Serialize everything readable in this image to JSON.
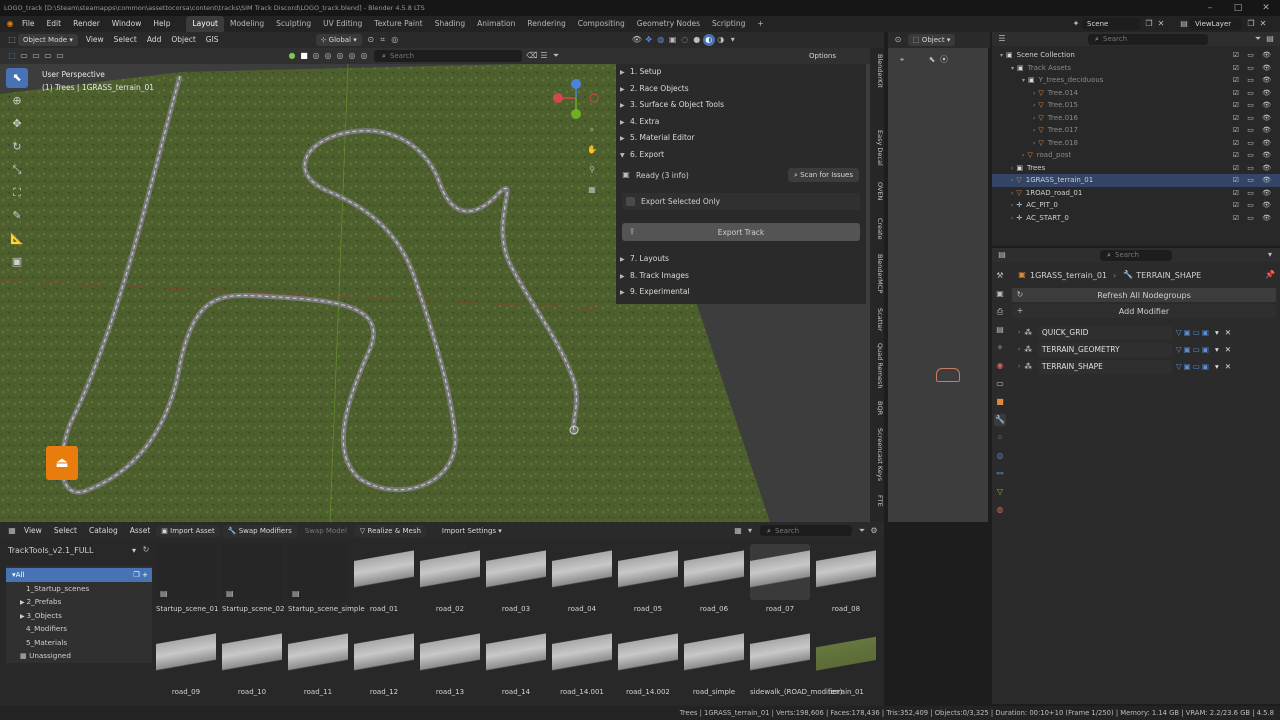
{
  "window": {
    "title": "LOGO_track [D:\\Steam\\steamapps\\common\\assettocorsa\\content\\tracks\\SIM Track Discord\\LOGO_track.blend] - Blender 4.5.8 LTS"
  },
  "menu": [
    "File",
    "Edit",
    "Render",
    "Window",
    "Help"
  ],
  "workspaces": [
    "Layout",
    "Modeling",
    "Sculpting",
    "UV Editing",
    "Texture Paint",
    "Shading",
    "Animation",
    "Rendering",
    "Compositing",
    "Geometry Nodes",
    "Scripting"
  ],
  "scene_name": "Scene",
  "viewlayer_name": "ViewLayer",
  "viewport": {
    "mode": "Object Mode",
    "menus": [
      "View",
      "Select",
      "Add",
      "Object",
      "GIS"
    ],
    "transform": "Global",
    "search_placeholder": "Search",
    "options": "Options",
    "info_line1": "User Perspective",
    "info_line2": "(1) Trees | 1GRASS_terrain_01"
  },
  "npanel": {
    "items": [
      "1. Setup",
      "2. Race Objects",
      "3. Surface & Object Tools",
      "4. Extra",
      "5. Material Editor",
      "6. Export"
    ],
    "status": "Ready (3 info)",
    "scan_button": "Scan for Issues",
    "export_selected": "Export Selected Only",
    "export_track": "Export Track",
    "items2": [
      "7. Layouts",
      "8. Track Images",
      "9. Experimental"
    ]
  },
  "vtabs": [
    "BlenderKit",
    "Easy Decal",
    "OVEN",
    "Create",
    "BlenderMCP",
    "Scatter",
    "Quad Remesh",
    "BQR",
    "Screencast Keys",
    "FTE"
  ],
  "right_viewport": {
    "mode": "Object"
  },
  "outliner": {
    "search_placeholder": "Search",
    "rows": [
      {
        "label": "Scene Collection",
        "indent": 0,
        "icon": "collection-icon"
      },
      {
        "label": "Track Assets",
        "indent": 1,
        "icon": "collection-icon",
        "dim": true
      },
      {
        "label": "Y_trees_deciduous",
        "indent": 2,
        "icon": "collection-icon",
        "dim": true
      },
      {
        "label": "Tree.014",
        "indent": 3,
        "icon": "mesh-icon",
        "dim": true
      },
      {
        "label": "Tree.015",
        "indent": 3,
        "icon": "mesh-icon",
        "dim": true
      },
      {
        "label": "Tree.016",
        "indent": 3,
        "icon": "mesh-icon",
        "dim": true
      },
      {
        "label": "Tree.017",
        "indent": 3,
        "icon": "mesh-icon",
        "dim": true
      },
      {
        "label": "Tree.018",
        "indent": 3,
        "icon": "mesh-icon",
        "dim": true
      },
      {
        "label": "road_post",
        "indent": 2,
        "icon": "mesh-icon",
        "dim": true
      },
      {
        "label": "Trees",
        "indent": 1,
        "icon": "collection-icon"
      },
      {
        "label": "1GRASS_terrain_01",
        "indent": 1,
        "icon": "mesh-icon"
      },
      {
        "label": "1ROAD_road_01",
        "indent": 1,
        "icon": "mesh-icon"
      },
      {
        "label": "AC_PIT_0",
        "indent": 1,
        "icon": "empty-icon"
      },
      {
        "label": "AC_START_0",
        "indent": 1,
        "icon": "empty-icon"
      }
    ]
  },
  "properties": {
    "search_placeholder": "Search",
    "object": "1GRASS_terrain_01",
    "modifier_path": "TERRAIN_SHAPE",
    "refresh": "Refresh All Nodegroups",
    "add_modifier": "Add Modifier",
    "modifiers": [
      "QUICK_GRID",
      "TERRAIN_GEOMETRY",
      "TERRAIN_SHAPE"
    ]
  },
  "asset_browser": {
    "menus": [
      "View",
      "Select",
      "Catalog",
      "Asset"
    ],
    "actions": [
      "Import Asset",
      "Swap Modifiers",
      "Swap Model",
      "Realize & Mesh"
    ],
    "import_settings": "Import Settings",
    "search_placeholder": "Search",
    "library": "TrackTools_v2.1_FULL",
    "catalogs": [
      "All",
      "1_Startup_scenes",
      "2_Prefabs",
      "3_Objects",
      "4_Modifiers",
      "5_Materials",
      "Unassigned"
    ],
    "row1": [
      "Startup_scene_01",
      "Startup_scene_02",
      "Startup_scene_simple",
      "road_01",
      "road_02",
      "road_03",
      "road_04",
      "road_05",
      "road_06",
      "road_07",
      "road_08"
    ],
    "row2": [
      "road_09",
      "road_10",
      "road_11",
      "road_12",
      "road_13",
      "road_14",
      "road_14.001",
      "road_14.002",
      "road_simple",
      "sidewalk_(ROAD_modifier)",
      "terrain_01"
    ]
  },
  "status": {
    "text": "Trees | 1GRASS_terrain_01 | Verts:198,606 | Faces:178,436 | Tris:352,409 | Objects:0/3,325 | Duration: 00:10+10 (Frame 1/250) | Memory: 1.14 GB | VRAM: 2.2/23.6 GB | 4.5.8"
  },
  "colors": {
    "accent": "#4772b3",
    "grass": "#4b5e2c",
    "outliner_mesh": "#e08a3c",
    "modifier_blue": "#5b8fd6"
  }
}
